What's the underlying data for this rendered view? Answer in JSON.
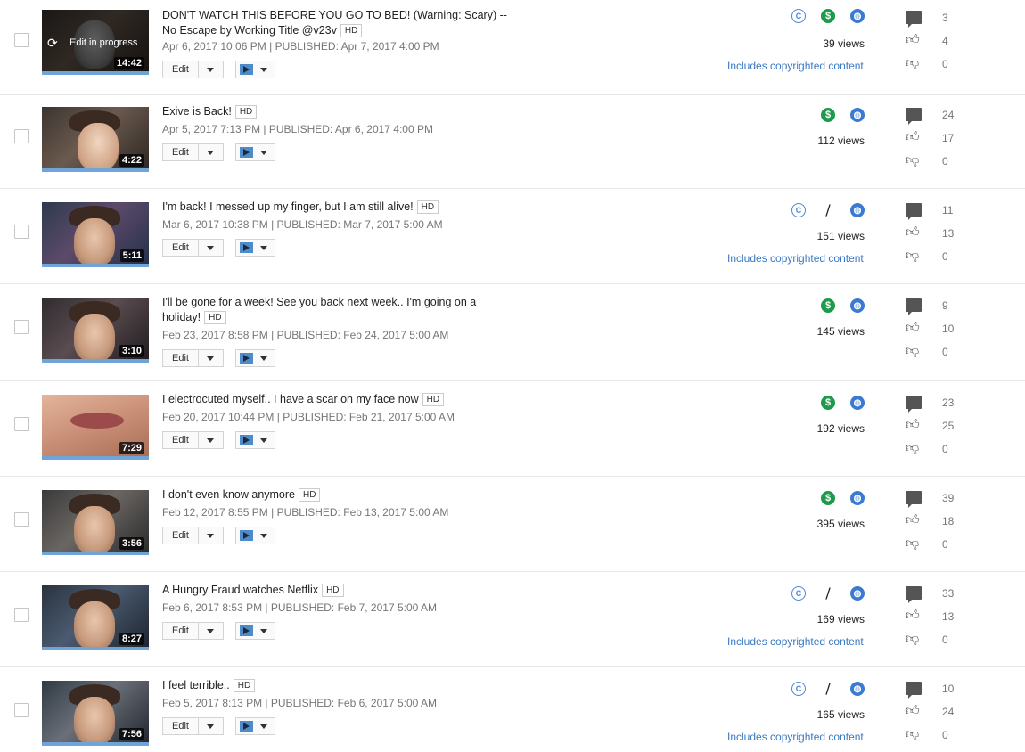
{
  "videos": [
    {
      "title": "DON'T WATCH THIS BEFORE YOU GO TO BED! (Warning: Scary) -- No Escape by Working Title @v23v",
      "hd": "HD",
      "created": "Apr 6, 2017 10:06 PM",
      "published": "PUBLISHED: Apr 7, 2017 4:00 PM",
      "duration": "14:42",
      "edit_in_progress": "Edit in progress",
      "views": "39 views",
      "copyright": "Includes copyrighted content",
      "comments": "3",
      "likes": "4",
      "dislikes": "0"
    },
    {
      "title": "Exive is Back!",
      "hd": "HD",
      "created": "Apr 5, 2017 7:13 PM",
      "published": "PUBLISHED: Apr 6, 2017 4:00 PM",
      "duration": "4:22",
      "views": "112 views",
      "comments": "24",
      "likes": "17",
      "dislikes": "0"
    },
    {
      "title": "I'm back! I messed up my finger, but I am still alive!",
      "hd": "HD",
      "created": "Mar 6, 2017 10:38 PM",
      "published": "PUBLISHED: Mar 7, 2017 5:00 AM",
      "duration": "5:11",
      "views": "151 views",
      "copyright": "Includes copyrighted content",
      "comments": "11",
      "likes": "13",
      "dislikes": "0"
    },
    {
      "title": "I'll be gone for a week! See you back next week.. I'm going on a holiday!",
      "hd": "HD",
      "created": "Feb 23, 2017 8:58 PM",
      "published": "PUBLISHED: Feb 24, 2017 5:00 AM",
      "duration": "3:10",
      "views": "145 views",
      "comments": "9",
      "likes": "10",
      "dislikes": "0"
    },
    {
      "title": "I electrocuted myself.. I have a scar on my face now",
      "hd": "HD",
      "created": "Feb 20, 2017 10:44 PM",
      "published": "PUBLISHED: Feb 21, 2017 5:00 AM",
      "duration": "7:29",
      "views": "192 views",
      "comments": "23",
      "likes": "25",
      "dislikes": "0"
    },
    {
      "title": "I don't even know anymore",
      "hd": "HD",
      "created": "Feb 12, 2017 8:55 PM",
      "published": "PUBLISHED: Feb 13, 2017 5:00 AM",
      "duration": "3:56",
      "views": "395 views",
      "comments": "39",
      "likes": "18",
      "dislikes": "0"
    },
    {
      "title": "A Hungry Fraud watches Netflix",
      "hd": "HD",
      "created": "Feb 6, 2017 8:53 PM",
      "published": "PUBLISHED: Feb 7, 2017 5:00 AM",
      "duration": "8:27",
      "views": "169 views",
      "copyright": "Includes copyrighted content",
      "comments": "33",
      "likes": "13",
      "dislikes": "0"
    },
    {
      "title": "I feel terrible..",
      "hd": "HD",
      "created": "Feb 5, 2017 8:13 PM",
      "published": "PUBLISHED: Feb 6, 2017 5:00 AM",
      "duration": "7:56",
      "views": "165 views",
      "copyright": "Includes copyrighted content",
      "comments": "10",
      "likes": "24",
      "dislikes": "0"
    }
  ],
  "labels": {
    "edit": "Edit",
    "separator": "|"
  },
  "colors": {
    "link": "#3a78c2",
    "monetized": "#1e9a4b",
    "public": "#3a7ad1",
    "progress": "#6fa4d9"
  }
}
